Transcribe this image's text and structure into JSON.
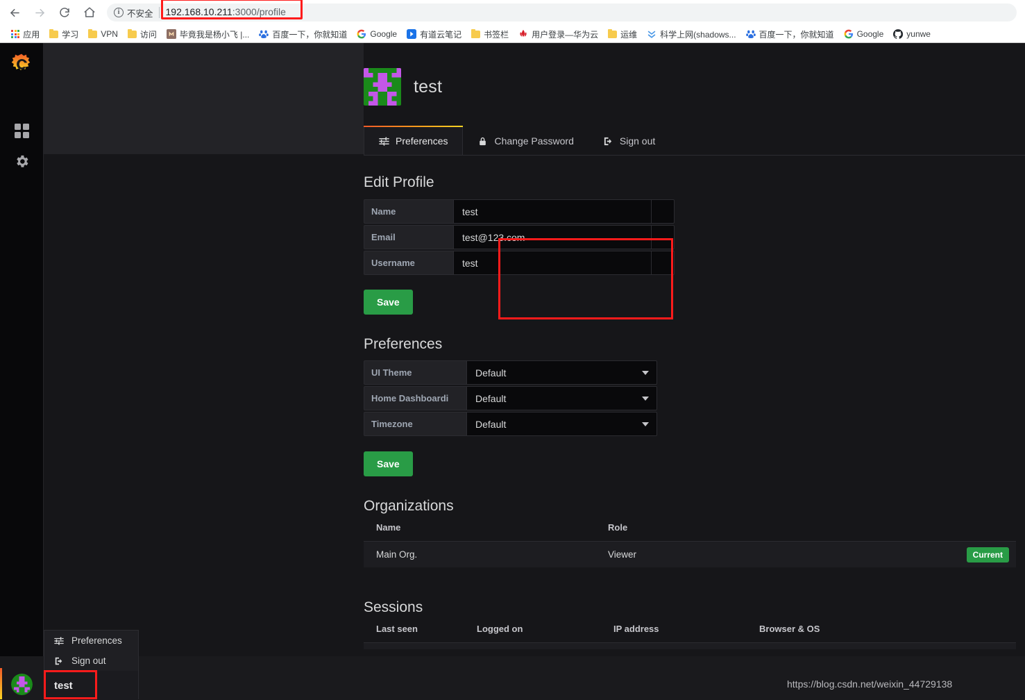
{
  "browser": {
    "back_icon": "back-arrow-icon",
    "forward_icon": "forward-arrow-icon",
    "reload_icon": "reload-icon",
    "home_icon": "home-icon",
    "security_label": "不安全",
    "security_icon": "info-circle-icon",
    "url_host": "192.168.10.211",
    "url_path": ":3000/profile",
    "url_full": "192.168.10.211:3000/profile",
    "url_highlight_color": "#ff1b1b",
    "bookmarks": [
      {
        "label": "应用",
        "icon": "apps-grid-icon"
      },
      {
        "label": "学习",
        "icon": "folder-icon"
      },
      {
        "label": "VPN",
        "icon": "folder-icon"
      },
      {
        "label": "访问",
        "icon": "folder-icon"
      },
      {
        "label": "毕竟我是杨小飞 |...",
        "icon": "site-icon"
      },
      {
        "label": "百度一下，你就知道",
        "icon": "baidu-icon"
      },
      {
        "label": "Google",
        "icon": "google-icon"
      },
      {
        "label": "有道云笔记",
        "icon": "youdao-icon"
      },
      {
        "label": "书签栏",
        "icon": "folder-icon"
      },
      {
        "label": "用户登录—华为云",
        "icon": "huawei-icon"
      },
      {
        "label": "运维",
        "icon": "folder-icon"
      },
      {
        "label": "科学上网(shadows...",
        "icon": "chevron-double-down-icon"
      },
      {
        "label": "百度一下，你就知道",
        "icon": "baidu-icon"
      },
      {
        "label": "Google",
        "icon": "google-icon"
      },
      {
        "label": "yunwe",
        "icon": "github-icon"
      }
    ]
  },
  "sidebar": {
    "logo_icon": "grafana-logo-icon",
    "items": [
      {
        "name": "dashboards",
        "icon": "four-squares-icon"
      },
      {
        "name": "configuration",
        "icon": "gear-icon"
      }
    ],
    "avatar_icon": "user-avatar-identicon"
  },
  "user_popup": {
    "items": [
      {
        "label": "Preferences",
        "icon": "sliders-icon"
      },
      {
        "label": "Sign out",
        "icon": "sign-out-icon"
      }
    ],
    "user_label": "test",
    "highlight_color": "#ff1b1b"
  },
  "profile": {
    "name": "test",
    "avatar_icon": "user-avatar-identicon",
    "tabs": [
      {
        "label": "Preferences",
        "icon": "sliders-icon",
        "active": true
      },
      {
        "label": "Change Password",
        "icon": "lock-icon",
        "active": false
      },
      {
        "label": "Sign out",
        "icon": "sign-out-icon",
        "active": false
      }
    ],
    "active_tab_gradient": [
      "#f05a28",
      "#fbd524"
    ]
  },
  "edit_profile": {
    "title": "Edit Profile",
    "fields": [
      {
        "label": "Name",
        "value": "test"
      },
      {
        "label": "Email",
        "value": "test@123.com"
      },
      {
        "label": "Username",
        "value": "test"
      }
    ],
    "save_label": "Save",
    "save_color": "#299c46",
    "highlight_color": "#ff1b1b"
  },
  "preferences": {
    "title": "Preferences",
    "fields": [
      {
        "label": "UI Theme",
        "value": "Default",
        "info": false
      },
      {
        "label": "Home Dashboard",
        "value": "Default",
        "info": true,
        "info_icon": "info-icon"
      },
      {
        "label": "Timezone",
        "value": "Default",
        "info": false
      }
    ],
    "save_label": "Save"
  },
  "organizations": {
    "title": "Organizations",
    "columns": [
      "Name",
      "Role"
    ],
    "rows": [
      {
        "name": "Main Org.",
        "role": "Viewer",
        "badge": "Current"
      }
    ],
    "badge_color": "#299c46"
  },
  "sessions": {
    "title": "Sessions",
    "columns": [
      "Last seen",
      "Logged on",
      "IP address",
      "Browser & OS"
    ]
  },
  "watermark": "https://blog.csdn.net/weixin_44729138"
}
